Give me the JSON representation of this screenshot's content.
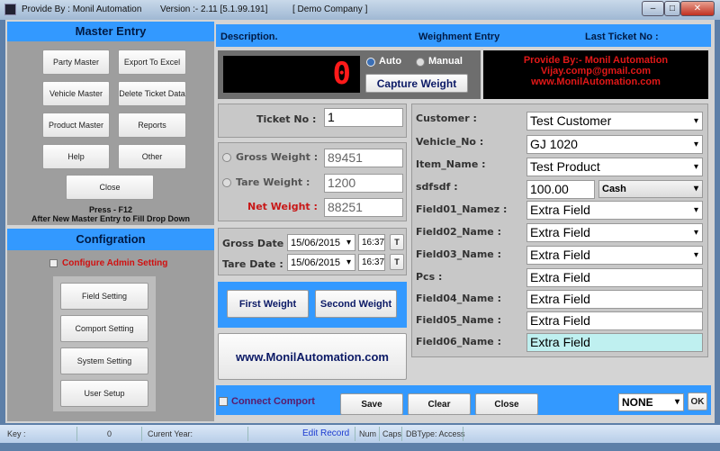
{
  "titlebar": {
    "provider": "Provide By : Monil Automation",
    "version": "Version :- 2.11 [5.1.99.191]",
    "company": "[ Demo Company ]"
  },
  "master": {
    "title": "Master Entry",
    "buttons": [
      "Party Master",
      "Export To Excel",
      "Vehicle Master",
      "Delete Ticket Data",
      "Product Master",
      "Reports",
      "Help",
      "Other"
    ],
    "close": "Close",
    "hint1": "Press - F12",
    "hint2": "After New Master Entry to Fill Drop Down"
  },
  "config": {
    "title": "Configration",
    "admin_label": "Configure Admin Setting",
    "buttons": [
      "Field Setting",
      "Comport Setting",
      "System Setting",
      "User Setup"
    ]
  },
  "header": {
    "description": "Description.",
    "title": "Weighment Entry",
    "last_ticket": "Last Ticket No :"
  },
  "scale": {
    "display": "0",
    "mode_auto": "Auto",
    "mode_manual": "Manual",
    "selected_mode": "Auto",
    "capture": "Capture Weight"
  },
  "promo": {
    "line1": "Provide By:- Monil Automation",
    "line2": "Vijay.comp@gmail.com",
    "line3": "www.MonilAutomation.com"
  },
  "ticket": {
    "label": "Ticket No :",
    "value": "1"
  },
  "weights": {
    "gross_label": "Gross Weight :",
    "gross": "89451",
    "tare_label": "Tare Weight  :",
    "tare": "1200",
    "net_label": "Net Weight :",
    "net": "88251"
  },
  "dates": {
    "gross_label": "Gross Date :",
    "gross_date": "15/06/2015",
    "gross_time": "16:37",
    "tare_label": "Tare Date :",
    "tare_date": "15/06/2015",
    "tare_time": "16:37",
    "t": "T"
  },
  "weigh_buttons": {
    "first": "First Weight",
    "second": "Second Weight"
  },
  "website": "www.MonilAutomation.com",
  "form": [
    {
      "label": "Customer :",
      "value": "Test Customer",
      "type": "select"
    },
    {
      "label": "Vehicle_No :",
      "value": "GJ 1020",
      "type": "select"
    },
    {
      "label": "Item_Name :",
      "value": "Test Product",
      "type": "select"
    },
    {
      "label": "sdfsdf  :",
      "value": "100.00",
      "extra": "Cash",
      "type": "split"
    },
    {
      "label": "Field01_Namez  :",
      "value": "Extra Field",
      "type": "select"
    },
    {
      "label": "Field02_Name :",
      "value": "Extra Field",
      "type": "select"
    },
    {
      "label": "Field03_Name :",
      "value": "Extra Field",
      "type": "select"
    },
    {
      "label": "Pcs :",
      "value": "Extra Field",
      "type": "text"
    },
    {
      "label": "Field04_Name :",
      "value": "Extra Field",
      "type": "text"
    },
    {
      "label": "Field05_Name :",
      "value": "Extra Field",
      "type": "text"
    },
    {
      "label": "Field06_Name :",
      "value": "Extra Field",
      "type": "text"
    }
  ],
  "bottom": {
    "connect": "Connect Comport",
    "save": "Save",
    "clear": "Clear",
    "close": "Close",
    "port": "NONE",
    "ok": "OK"
  },
  "status": {
    "key": "Key :",
    "key_val": "0",
    "year": "Curent Year:",
    "edit": "Edit Record",
    "num": "Num",
    "caps": "Caps",
    "db": "DBType: Access"
  },
  "colors": {
    "accent": "#3399ff",
    "display_red": "#ff1a1a"
  }
}
